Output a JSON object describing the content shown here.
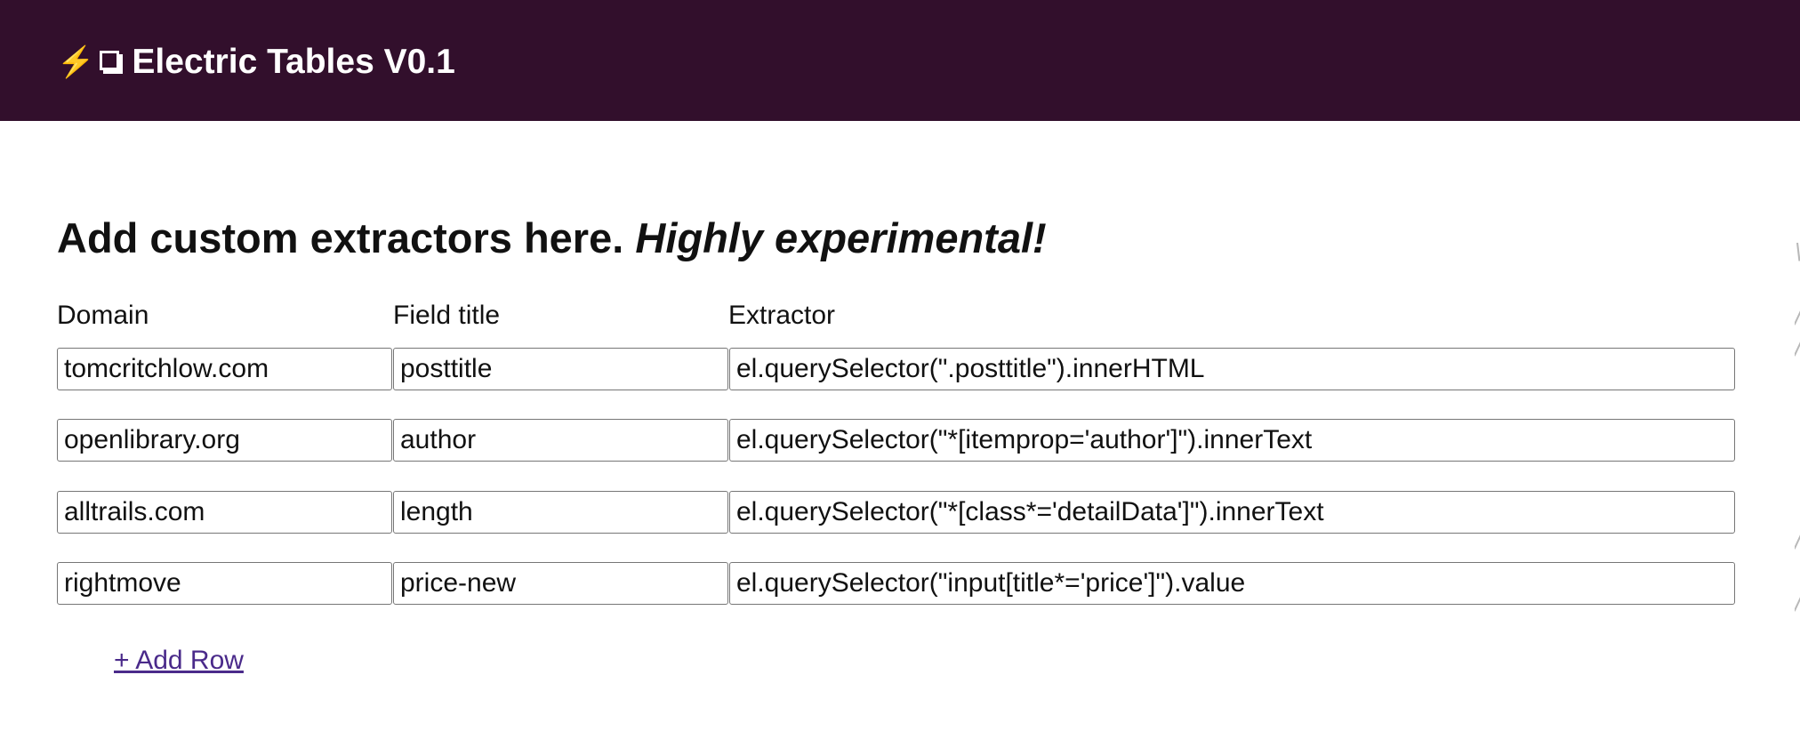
{
  "header": {
    "title": "Electric Tables V0.1"
  },
  "main": {
    "heading": "Add custom extractors here.",
    "heading_emphasis": "Highly experimental!",
    "columns": {
      "domain": "Domain",
      "field_title": "Field title",
      "extractor": "Extractor"
    },
    "rows": [
      {
        "domain": "tomcritchlow.com",
        "field": "posttitle",
        "extractor": "el.querySelector(\".posttitle\").innerHTML"
      },
      {
        "domain": "openlibrary.org",
        "field": "author",
        "extractor": "el.querySelector(\"*[itemprop='author']\").innerText"
      },
      {
        "domain": "alltrails.com",
        "field": "length",
        "extractor": "el.querySelector(\"*[class*='detailData']\").innerText"
      },
      {
        "domain": "rightmove",
        "field": "price-new",
        "extractor": "el.querySelector(\"input[title*='price']\").value"
      }
    ],
    "add_row_label": "+ Add Row"
  },
  "colors": {
    "header_bg": "#320f2c",
    "link": "#4a2a8a"
  }
}
